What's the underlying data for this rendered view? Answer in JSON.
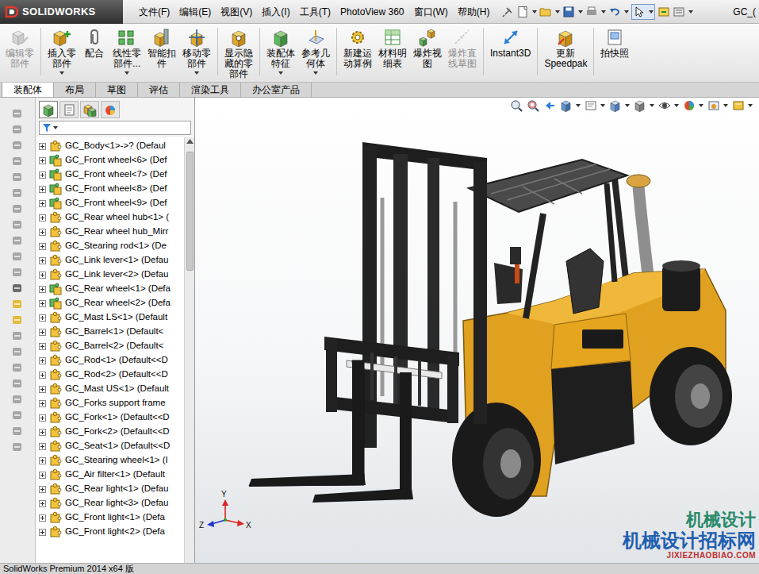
{
  "window": {
    "title": "GC_(",
    "logo": "SOLIDWORKS"
  },
  "menu": [
    "文件(F)",
    "编辑(E)",
    "视图(V)",
    "插入(I)",
    "工具(T)",
    "PhotoView 360",
    "窗口(W)",
    "帮助(H)"
  ],
  "command_buttons": [
    {
      "lines": [
        "编辑零",
        "部件"
      ],
      "disabled": true,
      "dropdown": false
    },
    {
      "lines": [
        "插入零",
        "部件"
      ],
      "disabled": false,
      "dropdown": true
    },
    {
      "lines": [
        "配合"
      ],
      "disabled": false,
      "dropdown": false
    },
    {
      "lines": [
        "线性零",
        "部件..."
      ],
      "disabled": false,
      "dropdown": true
    },
    {
      "lines": [
        "智能扣",
        "件"
      ],
      "disabled": false,
      "dropdown": false
    },
    {
      "lines": [
        "移动零",
        "部件"
      ],
      "disabled": false,
      "dropdown": true
    },
    {
      "lines": [
        "显示隐",
        "藏的零",
        "部件"
      ],
      "disabled": false,
      "dropdown": false
    },
    {
      "lines": [
        "装配体",
        "特征"
      ],
      "disabled": false,
      "dropdown": true
    },
    {
      "lines": [
        "参考几",
        "何体"
      ],
      "disabled": false,
      "dropdown": true
    },
    {
      "lines": [
        "新建运",
        "动算例"
      ],
      "disabled": false,
      "dropdown": false
    },
    {
      "lines": [
        "材料明",
        "细表"
      ],
      "disabled": false,
      "dropdown": false
    },
    {
      "lines": [
        "爆炸视",
        "图"
      ],
      "disabled": false,
      "dropdown": false
    },
    {
      "lines": [
        "爆炸直",
        "线草图"
      ],
      "disabled": true,
      "dropdown": false
    },
    {
      "lines": [
        "Instant3D"
      ],
      "disabled": false,
      "dropdown": false
    },
    {
      "lines": [
        "更新",
        "Speedpak"
      ],
      "disabled": false,
      "dropdown": false
    },
    {
      "lines": [
        "拍快照"
      ],
      "disabled": false,
      "dropdown": false
    }
  ],
  "tabs": [
    {
      "label": "装配体",
      "selected": true
    },
    {
      "label": "布局",
      "selected": false
    },
    {
      "label": "草图",
      "selected": false
    },
    {
      "label": "评估",
      "selected": false
    },
    {
      "label": "渲染工具",
      "selected": false
    },
    {
      "label": "办公室产品",
      "selected": false
    }
  ],
  "feature_tabs": [
    {
      "selected": true
    },
    {
      "selected": false
    },
    {
      "selected": false
    },
    {
      "selected": false
    }
  ],
  "tree": {
    "items": [
      {
        "label": "GC_Body<1>->? (Defaul",
        "kind": "part",
        "expanded": false
      },
      {
        "label": "GC_Front wheel<6> (Def",
        "kind": "assembly",
        "expanded": false
      },
      {
        "label": "GC_Front wheel<7> (Def",
        "kind": "assembly",
        "expanded": false
      },
      {
        "label": "GC_Front wheel<8> (Def",
        "kind": "assembly",
        "expanded": false
      },
      {
        "label": "GC_Front wheel<9> (Def",
        "kind": "assembly",
        "expanded": false
      },
      {
        "label": "GC_Rear wheel hub<1> (",
        "kind": "part",
        "expanded": false
      },
      {
        "label": "GC_Rear wheel hub_Mirr",
        "kind": "part",
        "expanded": false
      },
      {
        "label": "GC_Stearing rod<1> (De",
        "kind": "part",
        "expanded": false
      },
      {
        "label": "GC_Link lever<1> (Defau",
        "kind": "part",
        "expanded": false
      },
      {
        "label": "GC_Link lever<2> (Defau",
        "kind": "part",
        "expanded": false
      },
      {
        "label": "GC_Rear wheel<1> (Defa",
        "kind": "assembly",
        "expanded": false
      },
      {
        "label": "GC_Rear wheel<2> (Defa",
        "kind": "assembly",
        "expanded": false
      },
      {
        "label": "GC_Mast LS<1> (Default",
        "kind": "part",
        "expanded": false
      },
      {
        "label": "GC_Barrel<1> (Default<",
        "kind": "part",
        "expanded": false
      },
      {
        "label": "GC_Barrel<2> (Default<",
        "kind": "part",
        "expanded": false
      },
      {
        "label": "GC_Rod<1> (Default<<D",
        "kind": "part",
        "expanded": false
      },
      {
        "label": "GC_Rod<2> (Default<<D",
        "kind": "part",
        "expanded": false
      },
      {
        "label": "GC_Mast US<1> (Default",
        "kind": "part",
        "expanded": false
      },
      {
        "label": "GC_Forks support frame",
        "kind": "part",
        "expanded": false
      },
      {
        "label": "GC_Fork<1> (Default<<D",
        "kind": "part",
        "expanded": false
      },
      {
        "label": "GC_Fork<2> (Default<<D",
        "kind": "part",
        "expanded": false
      },
      {
        "label": "GC_Seat<1> (Default<<D",
        "kind": "part",
        "expanded": false
      },
      {
        "label": "GC_Stearing wheel<1> (I",
        "kind": "part",
        "expanded": false
      },
      {
        "label": "GC_Air filter<1> (Default",
        "kind": "part",
        "expanded": false
      },
      {
        "label": "GC_Rear light<1> (Defau",
        "kind": "part",
        "expanded": false
      },
      {
        "label": "GC_Rear light<3> (Defau",
        "kind": "part",
        "expanded": false
      },
      {
        "label": "GC_Front light<1> (Defa",
        "kind": "part",
        "expanded": false
      },
      {
        "label": "GC_Front light<2> (Defa",
        "kind": "part",
        "expanded": false
      }
    ]
  },
  "viewport": {
    "axes": [
      "Y",
      "X",
      "Z"
    ]
  },
  "watermark": [
    "机械设计",
    "机械设计招标网",
    "JIXIEZHAOBIAO.COM"
  ],
  "status_bar": "SolidWorks Premium 2014 x64 版"
}
